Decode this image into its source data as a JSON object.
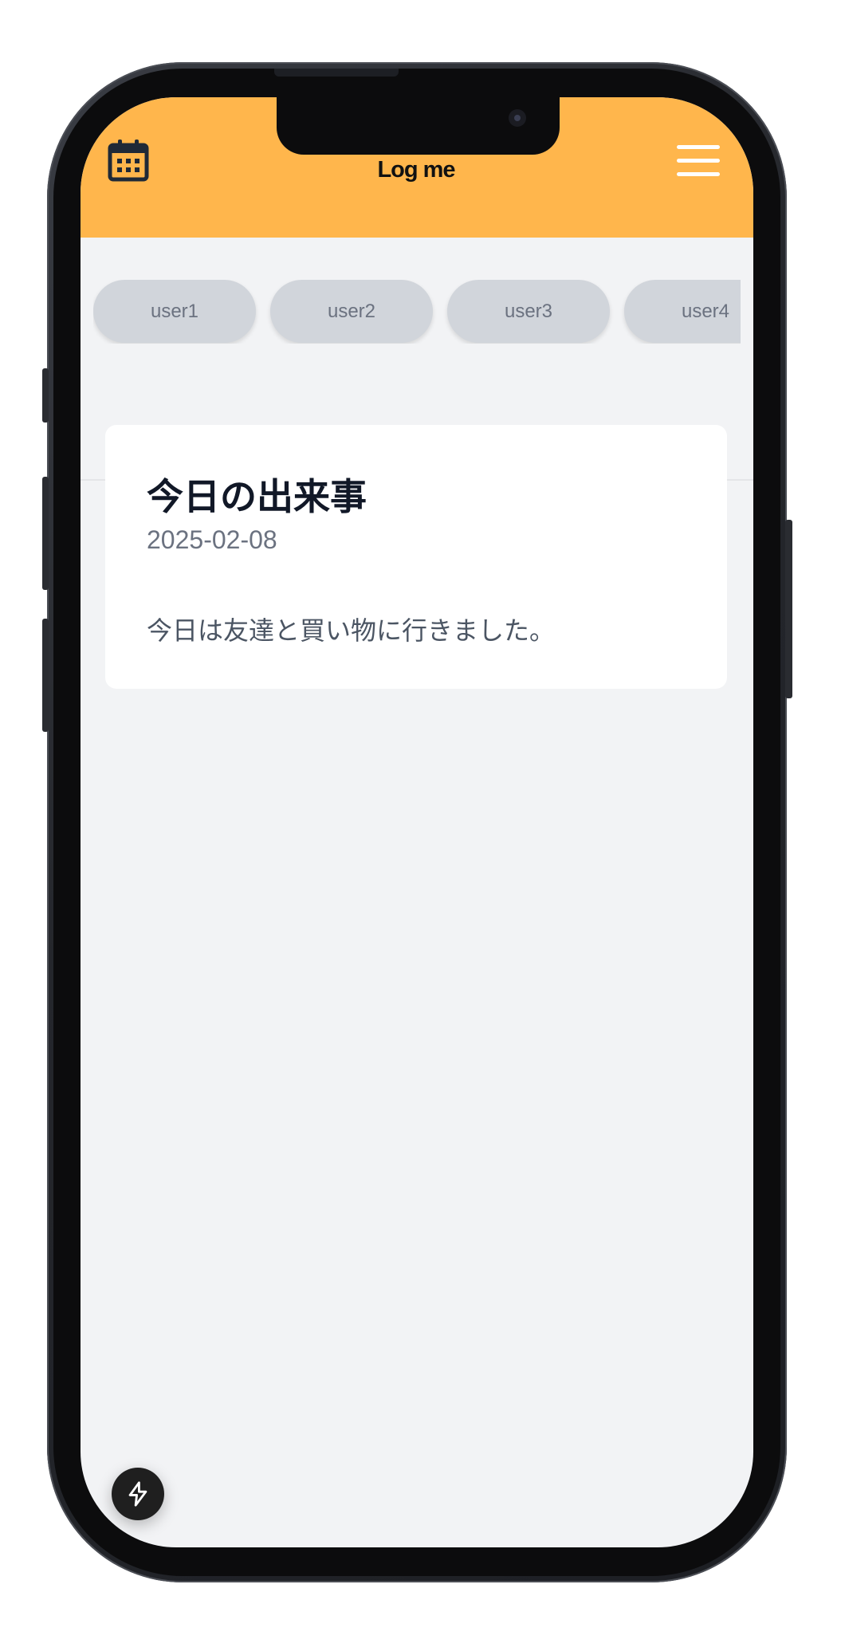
{
  "header": {
    "logo_text": "Log me",
    "background_color": "#ffb64c",
    "left_icon": "calendar-icon",
    "right_icon": "hamburger-menu-icon"
  },
  "user_tabs": [
    {
      "label": "user1"
    },
    {
      "label": "user2"
    },
    {
      "label": "user3"
    },
    {
      "label": "user4"
    }
  ],
  "entry": {
    "title": "今日の出来事",
    "date": "2025-02-08",
    "body": "今日は友達と買い物に行きました。"
  },
  "fab": {
    "icon": "lightning-bolt-icon"
  }
}
